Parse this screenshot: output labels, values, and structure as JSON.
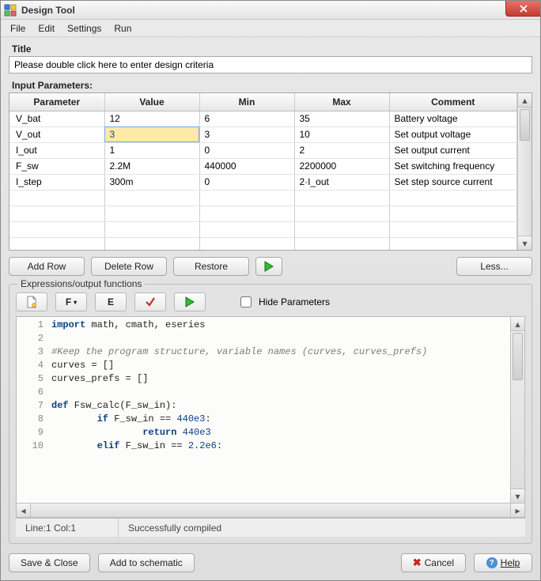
{
  "window": {
    "title": "Design Tool",
    "close_tooltip": "Close"
  },
  "menubar": [
    {
      "label": "File"
    },
    {
      "label": "Edit"
    },
    {
      "label": "Settings"
    },
    {
      "label": "Run"
    }
  ],
  "section": {
    "title_heading": "Title",
    "title_value": "Please double click here to enter design criteria",
    "input_params_heading": "Input Parameters:"
  },
  "table": {
    "columns": [
      "Parameter",
      "Value",
      "Min",
      "Max",
      "Comment"
    ],
    "rows": [
      {
        "parameter": "V_bat",
        "value": "12",
        "min": "6",
        "max": "35",
        "comment": "Battery voltage"
      },
      {
        "parameter": "V_out",
        "value": "3",
        "min": "3",
        "max": "10",
        "comment": "Set output voltage",
        "editing": true
      },
      {
        "parameter": "I_out",
        "value": "1",
        "min": "0",
        "max": "2",
        "comment": "Set output current"
      },
      {
        "parameter": "F_sw",
        "value": "2.2M",
        "min": "440000",
        "max": "2200000",
        "comment": "Set switching frequency"
      },
      {
        "parameter": "I_step",
        "value": "300m",
        "min": "0",
        "max": "2·I_out",
        "comment": "Set step source current"
      }
    ],
    "empty_rows": 4
  },
  "buttons": {
    "add_row": "Add Row",
    "delete_row": "Delete Row",
    "restore": "Restore",
    "less": "Less...",
    "save_close": "Save & Close",
    "add_schematic": "Add to schematic",
    "cancel": "Cancel",
    "help": "Help"
  },
  "expressions": {
    "legend": "Expressions/output functions",
    "toolbar": {
      "new": "New",
      "f": "F",
      "e": "E",
      "check": "Check",
      "run": "Run"
    },
    "hide_params_label": "Hide Parameters",
    "hide_params_checked": false,
    "code_lines": [
      {
        "n": 1,
        "raw": "import math, cmath, eseries",
        "kw": [
          "import"
        ]
      },
      {
        "n": 2,
        "raw": ""
      },
      {
        "n": 3,
        "raw": "#Keep the program structure, variable names (curves, curves_prefs)",
        "comment": true
      },
      {
        "n": 4,
        "raw": "curves = []"
      },
      {
        "n": 5,
        "raw": "curves_prefs = []"
      },
      {
        "n": 6,
        "raw": ""
      },
      {
        "n": 7,
        "raw": "def Fsw_calc(F_sw_in):",
        "kw": [
          "def"
        ]
      },
      {
        "n": 8,
        "raw": "        if F_sw_in == 440e3:",
        "kw": [
          "if"
        ],
        "num": [
          "440e3"
        ]
      },
      {
        "n": 9,
        "raw": "                return 440e3",
        "kw": [
          "return"
        ],
        "num": [
          "440e3"
        ]
      },
      {
        "n": 10,
        "raw": "        elif F_sw_in == 2.2e6:",
        "kw": [
          "elif"
        ],
        "num": [
          "2.2e6"
        ]
      }
    ],
    "status": {
      "pos": "Line:1 Col:1",
      "msg": "Successfully compiled"
    }
  }
}
